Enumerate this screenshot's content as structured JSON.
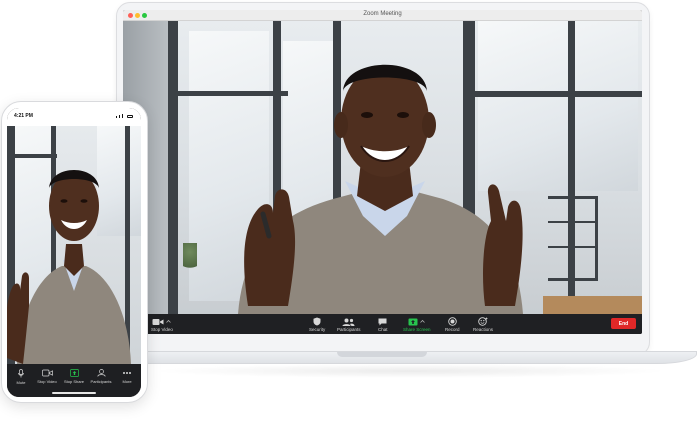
{
  "laptop": {
    "window_title": "Zoom Meeting",
    "toolbar": {
      "stop_video": "Stop Video",
      "security": "Security",
      "participants": "Participants",
      "chat": "Chat",
      "share_screen": "Share Screen",
      "record": "Record",
      "reactions": "Reactions",
      "end": "End"
    }
  },
  "phone": {
    "status_time": "4:21 PM",
    "toolbar": {
      "mute": "Mute",
      "stop_video": "Stop Video",
      "stop_share": "Stop Share",
      "participants": "Participants",
      "more": "More"
    }
  },
  "colors": {
    "share_screen_accent": "#27c44e",
    "end_button": "#e02828",
    "toolbar_bg": "#1f2023"
  },
  "icons": [
    "microphone-icon",
    "video-camera-icon",
    "shield-icon",
    "participants-icon",
    "chat-icon",
    "share-screen-icon",
    "record-icon",
    "reactions-icon",
    "more-icon",
    "chevron-up-icon"
  ]
}
